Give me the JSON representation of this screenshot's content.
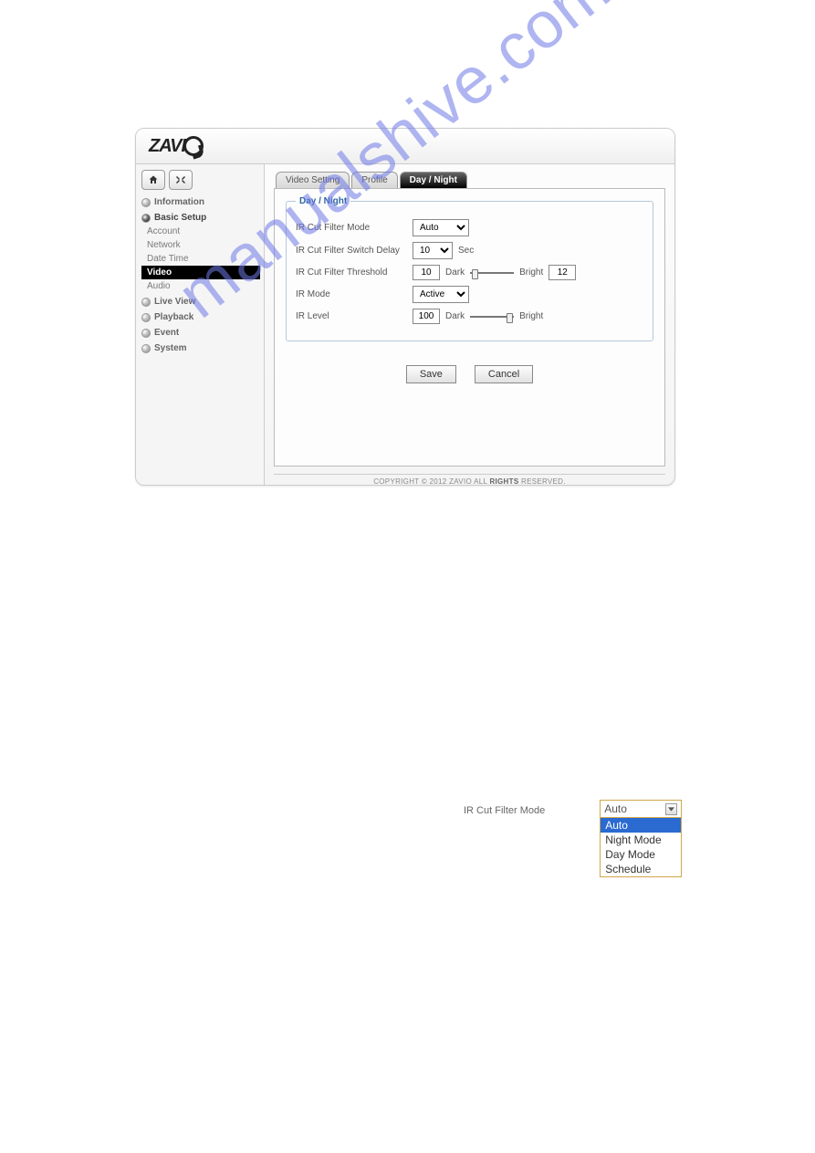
{
  "logo_text": "ZAVI",
  "sidebar": {
    "items": [
      {
        "label": "Information",
        "expanded": false
      },
      {
        "label": "Basic Setup",
        "expanded": true,
        "children": [
          {
            "label": "Account"
          },
          {
            "label": "Network"
          },
          {
            "label": "Date Time"
          },
          {
            "label": "Video",
            "selected": true
          },
          {
            "label": "Audio"
          }
        ]
      },
      {
        "label": "Live View"
      },
      {
        "label": "Playback"
      },
      {
        "label": "Event"
      },
      {
        "label": "System"
      }
    ]
  },
  "tabs": [
    {
      "label": "Video Setting"
    },
    {
      "label": "Profile"
    },
    {
      "label": "Day / Night",
      "active": true
    }
  ],
  "group_title": "Day / Night",
  "form": {
    "ir_cut_filter_mode": {
      "label": "IR Cut Filter Mode",
      "value": "Auto"
    },
    "ir_cut_filter_switch_delay": {
      "label": "IR Cut Filter Switch Delay",
      "value": "10",
      "unit": "Sec"
    },
    "ir_cut_filter_threshold": {
      "label": "IR Cut Filter Threshold",
      "low_value": "10",
      "low_label": "Dark",
      "high_label": "Bright",
      "high_value": "12"
    },
    "ir_mode": {
      "label": "IR Mode",
      "value": "Active"
    },
    "ir_level": {
      "label": "IR Level",
      "value": "100",
      "low_label": "Dark",
      "high_label": "Bright"
    }
  },
  "buttons": {
    "save": "Save",
    "cancel": "Cancel"
  },
  "footer": {
    "pre": "COPYRIGHT © 2012 ZAVIO ALL ",
    "bold": "RIGHTS",
    "post": " RESERVED."
  },
  "standalone": {
    "label": "IR Cut Filter Mode",
    "selected": "Auto",
    "options": [
      "Auto",
      "Night Mode",
      "Day Mode",
      "Schedule"
    ]
  },
  "watermark": "manualshive.com"
}
